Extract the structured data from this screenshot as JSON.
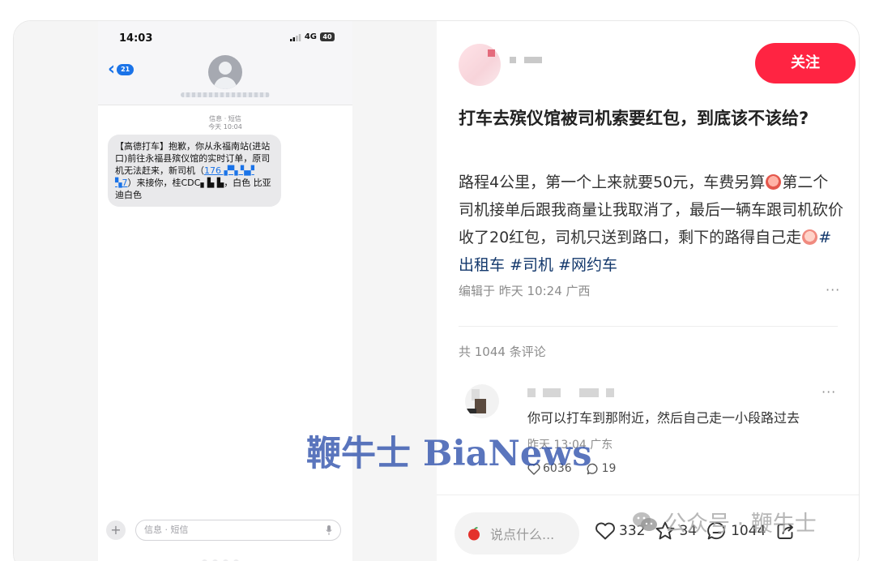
{
  "phone": {
    "status_time": "14:03",
    "network": "4G",
    "battery": "40",
    "back_badge": "21",
    "message_meta_line1": "信息 · 短信",
    "message_meta_line2": "今天 10:04",
    "sms_prefix": "【高德打车】抱歉，你从永福南站(进站口)前往永福县殡仪馆的实时订单，原司机无法赶来，新司机（",
    "sms_phone_masked": "176",
    "sms_phone_tail": "7",
    "sms_middle": "）来接你，桂CDC",
    "sms_suffix": "，白色 比亚迪白色",
    "compose_placeholder": "信息 · 短信"
  },
  "post": {
    "follow_label": "关注",
    "title": "打车去殡仪馆被司机索要红包，到底该不该给?",
    "body_part1": "路程4公里，第一个上来就要50元，车费另算",
    "body_part2": "第二个司机接单后跟我商量让我取消了，最后一辆车跟司机砍价收了20红包，司机只送到路口，剩下的路得自己走",
    "tags": [
      "#出租车",
      "#司机",
      "#网约车"
    ],
    "edited": "编辑于 昨天 10:24 广西",
    "comment_total": "共 1044 条评论"
  },
  "comment": {
    "text": "你可以打车到那附近，然后自己走一小段路过去",
    "meta": "昨天 13:04 广东",
    "likes": "6036",
    "replies": "19"
  },
  "bottom_bar": {
    "input_placeholder": "说点什么...",
    "likes": "332",
    "stars": "34",
    "comments": "1044"
  },
  "watermarks": {
    "main": "鞭牛士 BiaNews",
    "wechat": "公众号 · 鞭牛士"
  },
  "colors": {
    "follow_button": "#ff2442",
    "tag": "#13386c",
    "ios_blue": "#1a73e8",
    "watermark": "#2c4eaa"
  }
}
